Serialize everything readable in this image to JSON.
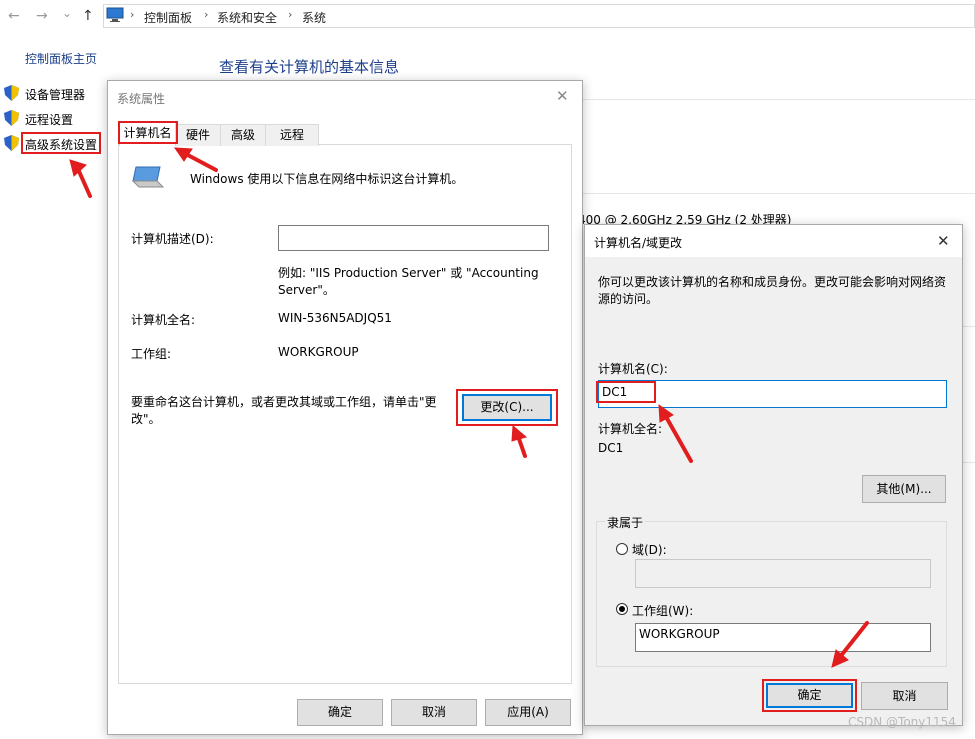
{
  "address_bar": {
    "back_icon": "←",
    "forward_icon": "→",
    "recent_icon": "⌄",
    "up_icon": "↑",
    "crumbs": [
      "控制面板",
      "系统和安全",
      "系统"
    ],
    "separator": "›"
  },
  "left_pane": {
    "home": "控制面板主页",
    "items": [
      "设备管理器",
      "远程设置",
      "高级系统设置"
    ]
  },
  "main": {
    "title": "查看有关计算机的基本信息",
    "cpu_fragment": "400 @ 2.60GHz   2.59 GHz  (2 处理器)"
  },
  "sys_props": {
    "title": "系统属性",
    "close": "✕",
    "tabs": [
      "计算机名",
      "硬件",
      "高级",
      "远程"
    ],
    "intro": "Windows 使用以下信息在网络中标识这台计算机。",
    "desc_label": "计算机描述(D):",
    "desc_value": "",
    "example_line1": "例如: \"IIS Production Server\" 或 \"Accounting",
    "example_line2": "Server\"。",
    "fullname_label": "计算机全名:",
    "fullname_value": "WIN-536N5ADJQ51",
    "workgroup_label": "工作组:",
    "workgroup_value": "WORKGROUP",
    "rename_line1": "要重命名这台计算机，或者更改其域或工作组，请单击\"更",
    "rename_line2": "改\"。",
    "change_button": "更改(C)...",
    "ok": "确定",
    "cancel": "取消",
    "apply": "应用(A)"
  },
  "rename_dialog": {
    "title": "计算机名/域更改",
    "close": "✕",
    "intro_line1": "你可以更改该计算机的名称和成员身份。更改可能会影响对网络资",
    "intro_line2": "源的访问。",
    "name_label": "计算机名(C):",
    "name_value": "DC1",
    "fullname_label": "计算机全名:",
    "fullname_value": "DC1",
    "more_button": "其他(M)...",
    "member_of": "隶属于",
    "domain_label": "域(D):",
    "domain_value": "",
    "workgroup_label": "工作组(W):",
    "workgroup_value": "WORKGROUP",
    "ok": "确定",
    "cancel": "取消"
  },
  "watermark": "CSDN @Tony1154",
  "colors": {
    "annotation_red": "#e21d1d",
    "link_blue": "#1e3f8c",
    "focus_blue": "#0078d7"
  }
}
